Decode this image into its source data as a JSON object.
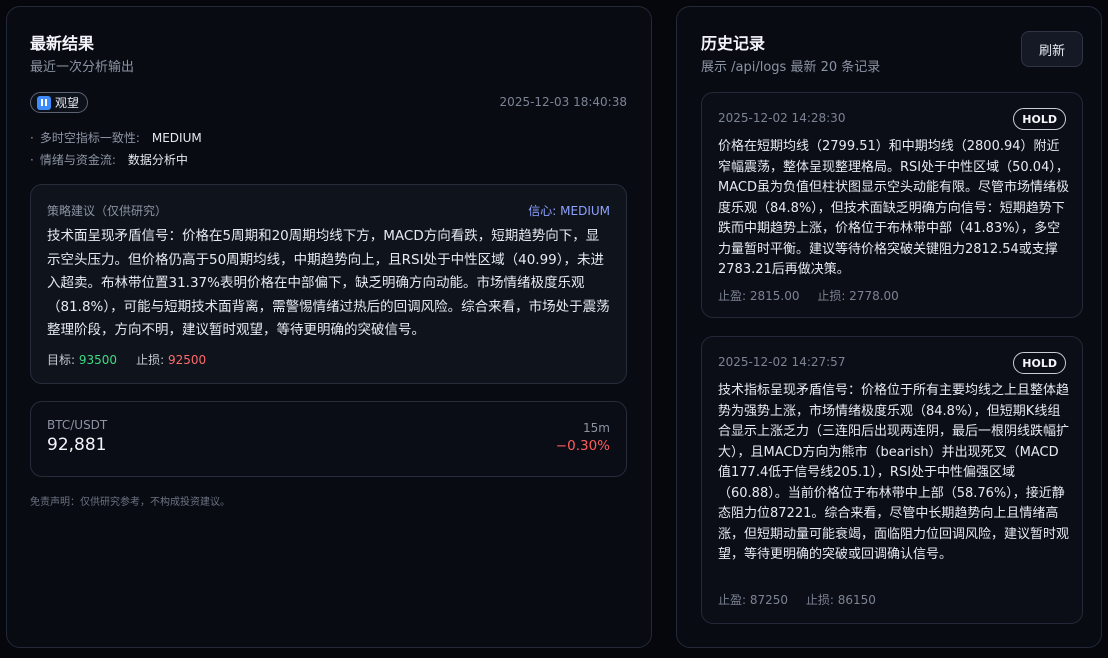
{
  "latest": {
    "title": "最新结果",
    "subtitle": "最近一次分析输出",
    "status_label": "观望",
    "status_icon": "pause-icon",
    "timestamp": "2025-12-03 18:40:38",
    "meta": [
      {
        "label": "多时空指标一致性:",
        "value": "MEDIUM"
      },
      {
        "label": "情绪与资金流:",
        "value": "数据分析中"
      }
    ],
    "strategy": {
      "title": "策略建议（仅供研究）",
      "confidence": "信心: MEDIUM",
      "body": "技术面呈现矛盾信号：价格在5周期和20周期均线下方，MACD方向看跌，短期趋势向下，显示空头压力。但价格仍高于50周期均线，中期趋势向上，且RSI处于中性区域（40.99），未进入超卖。布林带位置31.37%表明价格在中部偏下，缺乏明确方向动能。市场情绪极度乐观（81.8%），可能与短期技术面背离，需警惕情绪过热后的回调风险。综合来看，市场处于震荡整理阶段，方向不明，建议暂时观望，等待更明确的突破信号。",
      "target_label": "目标:",
      "target_value": "93500",
      "stop_label": "止损:",
      "stop_value": "92500"
    },
    "ticker": {
      "pair": "BTC/USDT",
      "price": "92,881",
      "timeframe": "15m",
      "change": "−0.30%"
    },
    "disclaimer": "免责声明：仅供研究参考，不构成投资建议。",
    "colors": {
      "positive": "#3ddc84",
      "negative": "#ff6b6b",
      "accent": "#8ea2ff"
    }
  },
  "history": {
    "title": "历史记录",
    "subtitle": "展示 /api/logs 最新 20 条记录",
    "refresh_label": "刷新",
    "records": [
      {
        "time": "2025-12-02 14:28:30",
        "action": "HOLD",
        "body": "价格在短期均线（2799.51）和中期均线（2800.94）附近窄幅震荡，整体呈现整理格局。RSI处于中性区域（50.04），MACD虽为负值但柱状图显示空头动能有限。尽管市场情绪极度乐观（84.8%），但技术面缺乏明确方向信号：短期趋势下跌而中期趋势上涨，价格位于布林带中部（41.83%），多空力量暂时平衡。建议等待价格突破关键阻力2812.54或支撑2783.21后再做决策。",
        "tp": "止盈: 2815.00",
        "sl": "止损: 2778.00"
      },
      {
        "time": "2025-12-02 14:27:57",
        "action": "HOLD",
        "body": "技术指标呈现矛盾信号：价格位于所有主要均线之上且整体趋势为强势上涨，市场情绪极度乐观（84.8%），但短期K线组合显示上涨乏力（三连阳后出现两连阴，最后一根阴线跌幅扩大），且MACD方向为熊市（bearish）并出现死叉（MACD值177.4低于信号线205.1），RSI处于中性偏强区域（60.88）。当前价格位于布林带中上部（58.76%），接近静态阻力位87221。综合来看，尽管中长期趋势向上且情绪高涨，但短期动量可能衰竭，面临阻力位回调风险，建议暂时观望，等待更明确的突破或回调确认信号。",
        "tp": "止盈: 87250",
        "sl": "止损: 86150"
      }
    ]
  }
}
